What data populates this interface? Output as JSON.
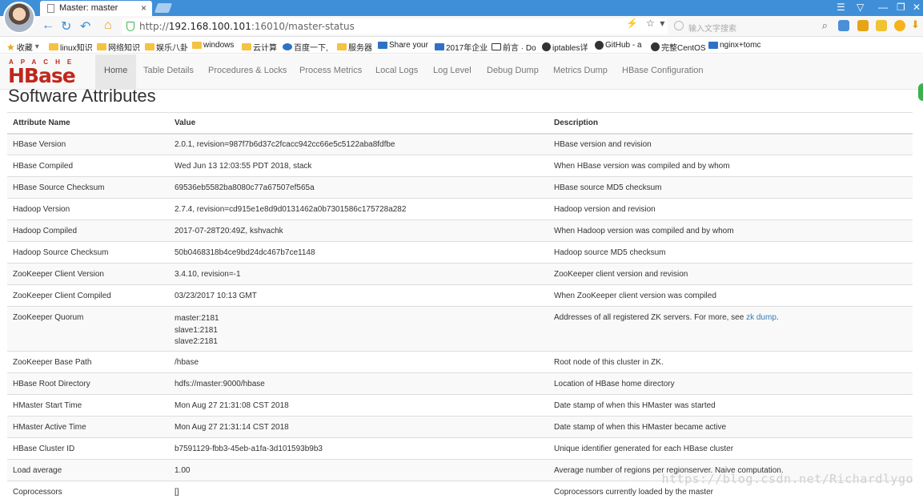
{
  "browser": {
    "tab_title": "Master: master",
    "tab_close": "×",
    "url_prefix": "http://",
    "url_host": "192.168.100.101",
    "url_path": ":16010/master-status",
    "search_placeholder": "输入文字搜索",
    "bookmarks": [
      {
        "label": "收藏",
        "icon": "star"
      },
      {
        "label": "linux知识",
        "icon": "folder"
      },
      {
        "label": "网络知识",
        "icon": "folder"
      },
      {
        "label": "娱乐八卦",
        "icon": "folder"
      },
      {
        "label": "windows",
        "icon": "folder"
      },
      {
        "label": "云计算",
        "icon": "folder"
      },
      {
        "label": "百度一下,",
        "icon": "paw"
      },
      {
        "label": "服务器",
        "icon": "folder"
      },
      {
        "label": "Share your",
        "icon": "blue"
      },
      {
        "label": "2017年企业",
        "icon": "blue"
      },
      {
        "label": "前言 · Do",
        "icon": "book"
      },
      {
        "label": "iptables详",
        "icon": "dark"
      },
      {
        "label": "GitHub - a",
        "icon": "github"
      },
      {
        "label": "完整CentOS",
        "icon": "dark"
      },
      {
        "label": "nginx+tomc",
        "icon": "blue"
      }
    ]
  },
  "nav": {
    "logo_top": "APACHE",
    "logo_main": "HBase",
    "items": [
      "Home",
      "Table Details",
      "Procedures & Locks",
      "Process Metrics",
      "Local Logs",
      "Log Level",
      "Debug Dump",
      "Metrics Dump",
      "HBase Configuration"
    ],
    "active_index": 0
  },
  "page": {
    "title": "Software Attributes",
    "columns": [
      "Attribute Name",
      "Value",
      "Description"
    ],
    "rows": [
      {
        "name": "HBase Version",
        "value": "2.0.1, revision=987f7b6d37c2fcacc942cc66e5c5122aba8fdfbe",
        "desc": "HBase version and revision"
      },
      {
        "name": "HBase Compiled",
        "value": "Wed Jun 13 12:03:55 PDT 2018, stack",
        "desc": "When HBase version was compiled and by whom"
      },
      {
        "name": "HBase Source Checksum",
        "value": "69536eb5582ba8080c77a67507ef565a",
        "desc": "HBase source MD5 checksum"
      },
      {
        "name": "Hadoop Version",
        "value": "2.7.4, revision=cd915e1e8d9d0131462a0b7301586c175728a282",
        "desc": "Hadoop version and revision"
      },
      {
        "name": "Hadoop Compiled",
        "value": "2017-07-28T20:49Z, kshvachk",
        "desc": "When Hadoop version was compiled and by whom"
      },
      {
        "name": "Hadoop Source Checksum",
        "value": "50b0468318b4ce9bd24dc467b7ce1148",
        "desc": "Hadoop source MD5 checksum"
      },
      {
        "name": "ZooKeeper Client Version",
        "value": "3.4.10, revision=-1",
        "desc": "ZooKeeper client version and revision"
      },
      {
        "name": "ZooKeeper Client Compiled",
        "value": "03/23/2017 10:13 GMT",
        "desc": "When ZooKeeper client version was compiled"
      },
      {
        "name": "ZooKeeper Quorum",
        "value_lines": [
          "master:2181",
          "slave1:2181",
          "slave2:2181"
        ],
        "desc": "Addresses of all registered ZK servers. For more, see ",
        "desc_link": "zk dump",
        "desc_tail": "."
      },
      {
        "name": "ZooKeeper Base Path",
        "value": "/hbase",
        "desc": "Root node of this cluster in ZK."
      },
      {
        "name": "HBase Root Directory",
        "value": "hdfs://master:9000/hbase",
        "desc": "Location of HBase home directory"
      },
      {
        "name": "HMaster Start Time",
        "value": "Mon Aug 27 21:31:08 CST 2018",
        "desc": "Date stamp of when this HMaster was started"
      },
      {
        "name": "HMaster Active Time",
        "value": "Mon Aug 27 21:31:14 CST 2018",
        "desc": "Date stamp of when this HMaster became active"
      },
      {
        "name": "HBase Cluster ID",
        "value": "b7591129-fbb3-45eb-a1fa-3d101593b9b3",
        "desc": "Unique identifier generated for each HBase cluster"
      },
      {
        "name": "Load average",
        "value": "1.00",
        "desc": "Average number of regions per regionserver. Naive computation."
      },
      {
        "name": "Coprocessors",
        "value": "[]",
        "desc": "Coprocessors currently loaded by the master"
      }
    ]
  },
  "watermark": "https://blog.csdn.net/Richardlygo",
  "colors": {
    "accent": "#3f8fd8",
    "brand": "#c0271c",
    "link": "#337ab7"
  }
}
